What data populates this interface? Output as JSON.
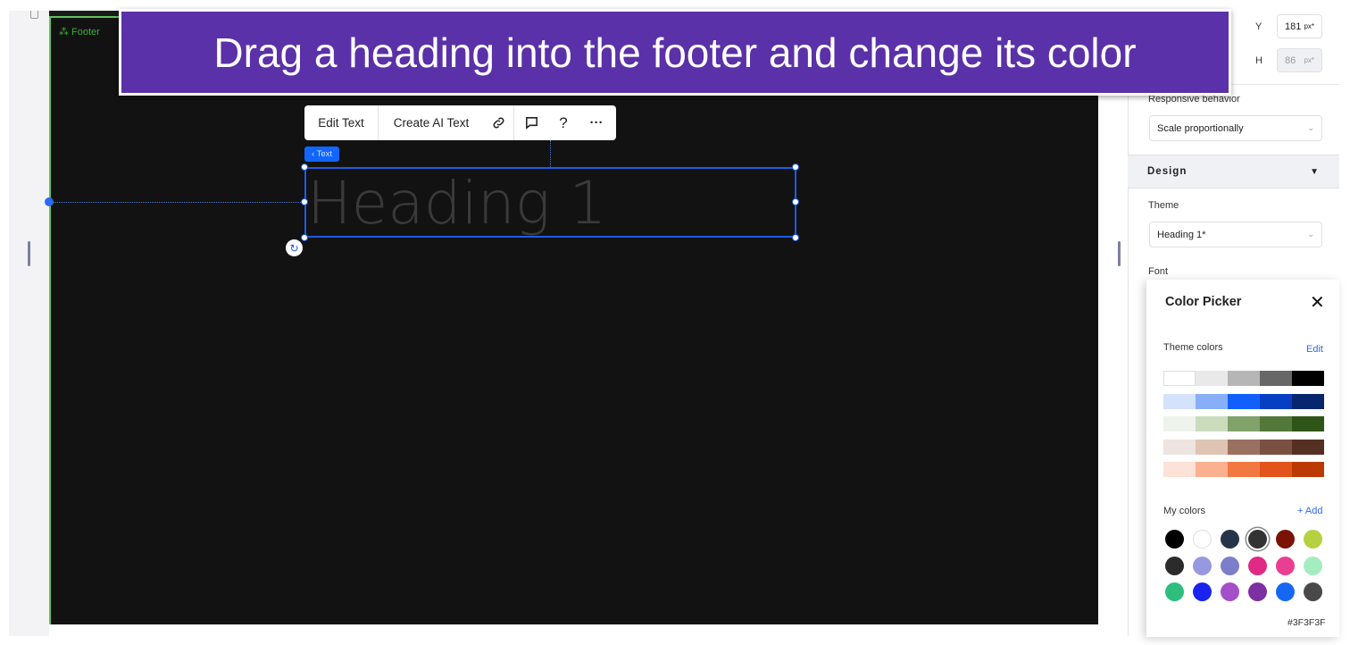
{
  "banner": {
    "text": "Drag a heading into the footer and change its color"
  },
  "canvas": {
    "section_label": "Footer",
    "text_tag": "‹ Text",
    "heading_text": "Heading 1"
  },
  "toolbar": {
    "edit_text": "Edit Text",
    "create_ai_text": "Create AI Text",
    "link_icon": "link-icon",
    "comment_icon": "comment-icon",
    "help": "?",
    "more": "···"
  },
  "panel": {
    "y_label": "Y",
    "y_value": "181",
    "y_unit": "px*",
    "h_label": "H",
    "h_value": "86",
    "h_unit": "px*",
    "responsive_label": "Responsive behavior",
    "responsive_value": "Scale proportionally",
    "design_label": "Design",
    "theme_label": "Theme",
    "theme_value": "Heading 1*",
    "font_label": "Font"
  },
  "color_picker": {
    "title": "Color Picker",
    "theme_colors_label": "Theme colors",
    "edit_label": "Edit",
    "theme_colors": [
      [
        "#ffffff",
        "#e9e9e9",
        "#b6b6b6",
        "#676767",
        "#000000"
      ],
      [
        "#d4e2fc",
        "#88aef8",
        "#1160fc",
        "#063fc4",
        "#06266e"
      ],
      [
        "#eef4ec",
        "#cbdcbd",
        "#81a26a",
        "#52783a",
        "#2f5418"
      ],
      [
        "#ede3df",
        "#dfc4b4",
        "#9a7160",
        "#7a5140",
        "#552f22"
      ],
      [
        "#fde2d7",
        "#fbb090",
        "#f27842",
        "#e2541b",
        "#bb3a04"
      ]
    ],
    "my_colors_label": "My colors",
    "add_label": "+ Add",
    "my_colors": [
      [
        "#000000",
        "#ffffff",
        "#263449",
        "#333333",
        "#7a1206",
        "#b5d140"
      ],
      [
        "#2b2b2b",
        "#9698e0",
        "#7d7ecb",
        "#e02a86",
        "#e83f92",
        "#a5edc0"
      ],
      [
        "#2dbe7e",
        "#1a24ee",
        "#a54ec9",
        "#7d30a1",
        "#1767f5",
        "#494949"
      ]
    ],
    "selected_color": "#333333",
    "hex_value": "#3F3F3F"
  }
}
